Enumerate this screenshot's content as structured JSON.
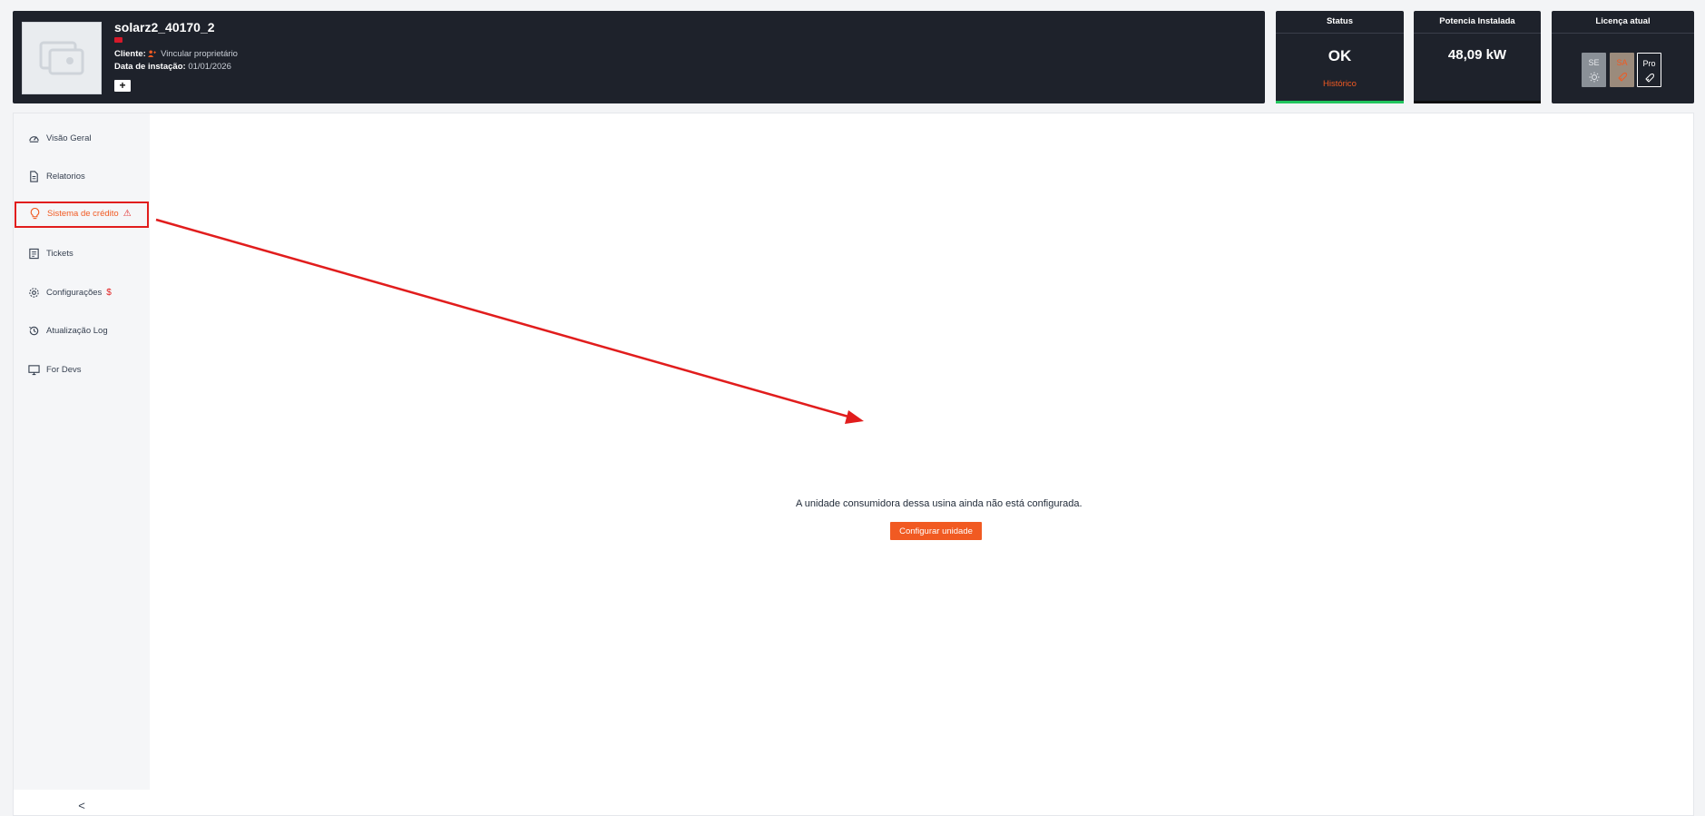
{
  "header": {
    "plant_name": "solarz2_40170_2",
    "client_label": "Cliente:",
    "client_link": "Vincular proprietário",
    "install_label": "Data de instação:",
    "install_date": "01/01/2026",
    "add_label": "+"
  },
  "cards": {
    "status": {
      "title": "Status",
      "value": "OK",
      "link": "Histórico"
    },
    "power": {
      "title": "Potencia Instalada",
      "value": "48,09 kW"
    },
    "license": {
      "title": "Licença atual",
      "badges": [
        "SE",
        "SA",
        "Pro"
      ]
    }
  },
  "sidebar": {
    "items": [
      {
        "label": "Visão Geral",
        "icon": "gauge-icon"
      },
      {
        "label": "Relatorios",
        "icon": "document-icon"
      },
      {
        "label": "Sistema de crédito",
        "icon": "lightbulb-icon",
        "warning": "⚠"
      },
      {
        "label": "Tickets",
        "icon": "ticket-icon"
      },
      {
        "label": "Configurações",
        "icon": "gear-icon",
        "warning": "$"
      },
      {
        "label": "Atualização Log",
        "icon": "history-icon"
      },
      {
        "label": "For Devs",
        "icon": "monitor-icon"
      }
    ],
    "collapse_label": "<"
  },
  "main": {
    "empty_message": "A unidade consumidora dessa usina ainda não está configurada.",
    "configure_button": "Configurar unidade"
  },
  "colors": {
    "accent": "#f15a22",
    "header_bg": "#1e222b",
    "status_ok": "#22c55e",
    "annotation": "#e11d1d"
  }
}
